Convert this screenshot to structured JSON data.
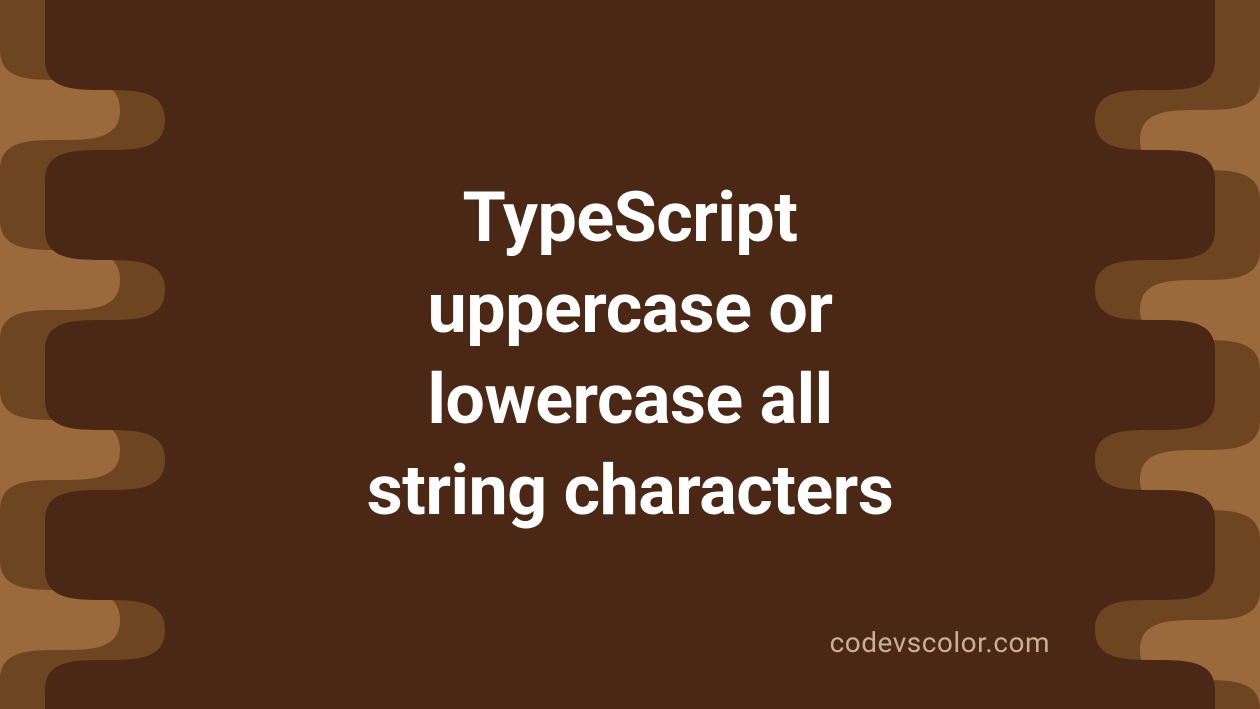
{
  "title_line1": "TypeScript",
  "title_line2": "uppercase or",
  "title_line3": "lowercase all",
  "title_line4": "string characters",
  "watermark": "codevscolor.com",
  "colors": {
    "background_outer": "#9a6a3c",
    "background_mid": "#6e4521",
    "background_inner": "#4a2815",
    "text": "#ffffff",
    "watermark": "#c9b096"
  }
}
